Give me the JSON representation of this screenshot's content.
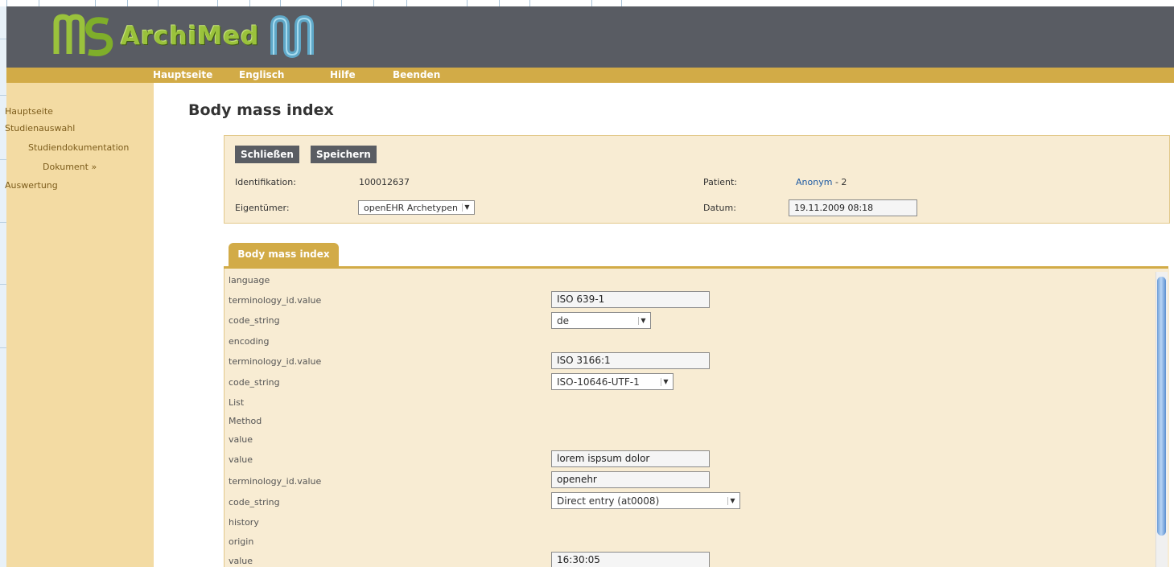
{
  "app": {
    "title": "ArchiMed"
  },
  "nav": {
    "items": [
      "Hauptseite",
      "Englisch",
      "Hilfe",
      "Beenden"
    ]
  },
  "sidebar": {
    "items": [
      "Hauptseite",
      "Studienauswahl",
      "Studiendokumentation",
      "Dokument »",
      "Auswertung"
    ]
  },
  "main": {
    "title": "Body mass index"
  },
  "panel": {
    "close_label": "Schließen",
    "save_label": "Speichern",
    "identification_label": "Identifikation:",
    "identification_value": "100012637",
    "owner_label": "Eigentümer:",
    "owner_value": "openEHR Archetypen",
    "patient_label": "Patient:",
    "patient_value": "Anonym",
    "patient_suffix": "- 2",
    "date_label": "Datum:",
    "date_value": "19.11.2009 08:18"
  },
  "tab": {
    "label": "Body mass index"
  },
  "form": {
    "rows": [
      {
        "label": "language"
      },
      {
        "label": "terminology_id.value",
        "input": "ISO 639-1"
      },
      {
        "label": "code_string",
        "select": "de"
      },
      {
        "label": "encoding"
      },
      {
        "label": "terminology_id.value",
        "input": "ISO 3166:1"
      },
      {
        "label": "code_string",
        "select": "ISO-10646-UTF-1"
      },
      {
        "label": "List"
      },
      {
        "label": "Method"
      },
      {
        "label": "value"
      },
      {
        "label": "value",
        "input": "lorem ispsum dolor"
      },
      {
        "label": "terminology_id.value",
        "input": "openehr"
      },
      {
        "label": "code_string",
        "select": "Direct entry (at0008)"
      },
      {
        "label": "history"
      },
      {
        "label": "origin"
      },
      {
        "label": "value",
        "input": "16:30:05"
      }
    ]
  },
  "colors": {
    "header_bg": "#595c63",
    "accent": "#d2ab47",
    "sidebar_bg": "#f3dba3",
    "panel_bg": "#f8ecd3",
    "button_bg": "#5a5d63",
    "link": "#1d5aa3"
  },
  "icons": {
    "logo_left": "ms-logo-icon",
    "logo_right": "m-logo-icon",
    "dropdown": "chevron-down-icon"
  }
}
